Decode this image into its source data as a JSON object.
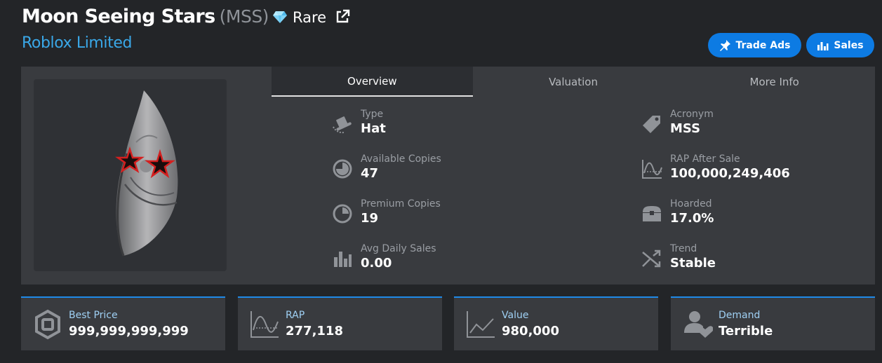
{
  "header": {
    "item_name": "Moon Seeing Stars",
    "acronym": "(MSS)",
    "rarity_icon": "diamond-icon",
    "rarity_label": "Rare",
    "external_link_icon": "external-link-icon",
    "subtitle": "Roblox Limited"
  },
  "actions": {
    "trade_ads_icon": "pin-icon",
    "trade_ads_label": "Trade Ads",
    "sales_icon": "bar-chart-icon",
    "sales_label": "Sales"
  },
  "tabs": [
    {
      "label": "Overview",
      "active": true
    },
    {
      "label": "Valuation",
      "active": false
    },
    {
      "label": "More Info",
      "active": false
    }
  ],
  "overview": {
    "left": [
      {
        "label": "Type",
        "value": "Hat",
        "icon": "hat-icon"
      },
      {
        "label": "Available Copies",
        "value": "47",
        "icon": "pie-full-icon"
      },
      {
        "label": "Premium Copies",
        "value": "19",
        "icon": "pie-quarter-icon"
      },
      {
        "label": "Avg Daily Sales",
        "value": "0.00",
        "icon": "bar-chart-icon"
      }
    ],
    "right": [
      {
        "label": "Acronym",
        "value": "MSS",
        "icon": "tag-icon"
      },
      {
        "label": "RAP After Sale",
        "value": "100,000,249,406",
        "icon": "wave-chart-icon"
      },
      {
        "label": "Hoarded",
        "value": "17.0%",
        "icon": "chest-icon"
      },
      {
        "label": "Trend",
        "value": "Stable",
        "icon": "shuffle-icon"
      }
    ]
  },
  "cards": [
    {
      "label": "Best Price",
      "value": "999,999,999,999",
      "icon": "robux-icon"
    },
    {
      "label": "RAP",
      "value": "277,118",
      "icon": "wave-chart-icon"
    },
    {
      "label": "Value",
      "value": "980,000",
      "icon": "line-chart-icon"
    },
    {
      "label": "Demand",
      "value": "Terrible",
      "icon": "user-heart-icon"
    }
  ],
  "colors": {
    "background": "#232528",
    "panel": "#393b3f",
    "accent": "#0d7be3",
    "link": "#3aa8e8",
    "card_label": "#9fd0f4"
  }
}
